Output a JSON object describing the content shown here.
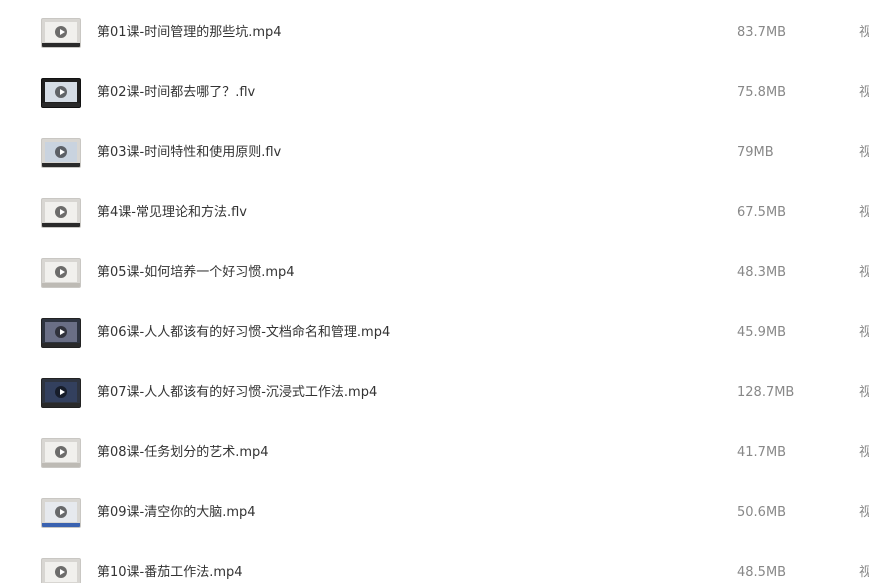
{
  "files": [
    {
      "name": "第01课-时间管理的那些坑.mp4",
      "size": "83.7MB",
      "type": "视频",
      "thumb_icon": "video-thumbnail-icon"
    },
    {
      "name": "第02课-时间都去哪了？.flv",
      "size": "75.8MB",
      "type": "视频",
      "thumb_icon": "video-thumbnail-icon"
    },
    {
      "name": "第03课-时间特性和使用原则.flv",
      "size": "79MB",
      "type": "视频",
      "thumb_icon": "video-thumbnail-icon"
    },
    {
      "name": "第4课-常见理论和方法.flv",
      "size": "67.5MB",
      "type": "视频",
      "thumb_icon": "video-thumbnail-icon"
    },
    {
      "name": "第05课-如何培养一个好习惯.mp4",
      "size": "48.3MB",
      "type": "视频",
      "thumb_icon": "video-thumbnail-icon"
    },
    {
      "name": "第06课-人人都该有的好习惯-文档命名和管理.mp4",
      "size": "45.9MB",
      "type": "视频",
      "thumb_icon": "video-thumbnail-icon"
    },
    {
      "name": "第07课-人人都该有的好习惯-沉浸式工作法.mp4",
      "size": "128.7MB",
      "type": "视频",
      "thumb_icon": "video-thumbnail-icon"
    },
    {
      "name": "第08课-任务划分的艺术.mp4",
      "size": "41.7MB",
      "type": "视频",
      "thumb_icon": "video-thumbnail-icon"
    },
    {
      "name": "第09课-清空你的大脑.mp4",
      "size": "50.6MB",
      "type": "视频",
      "thumb_icon": "video-thumbnail-icon"
    },
    {
      "name": "第10课-番茄工作法.mp4",
      "size": "48.5MB",
      "type": "视频",
      "thumb_icon": "video-thumbnail-icon"
    }
  ]
}
